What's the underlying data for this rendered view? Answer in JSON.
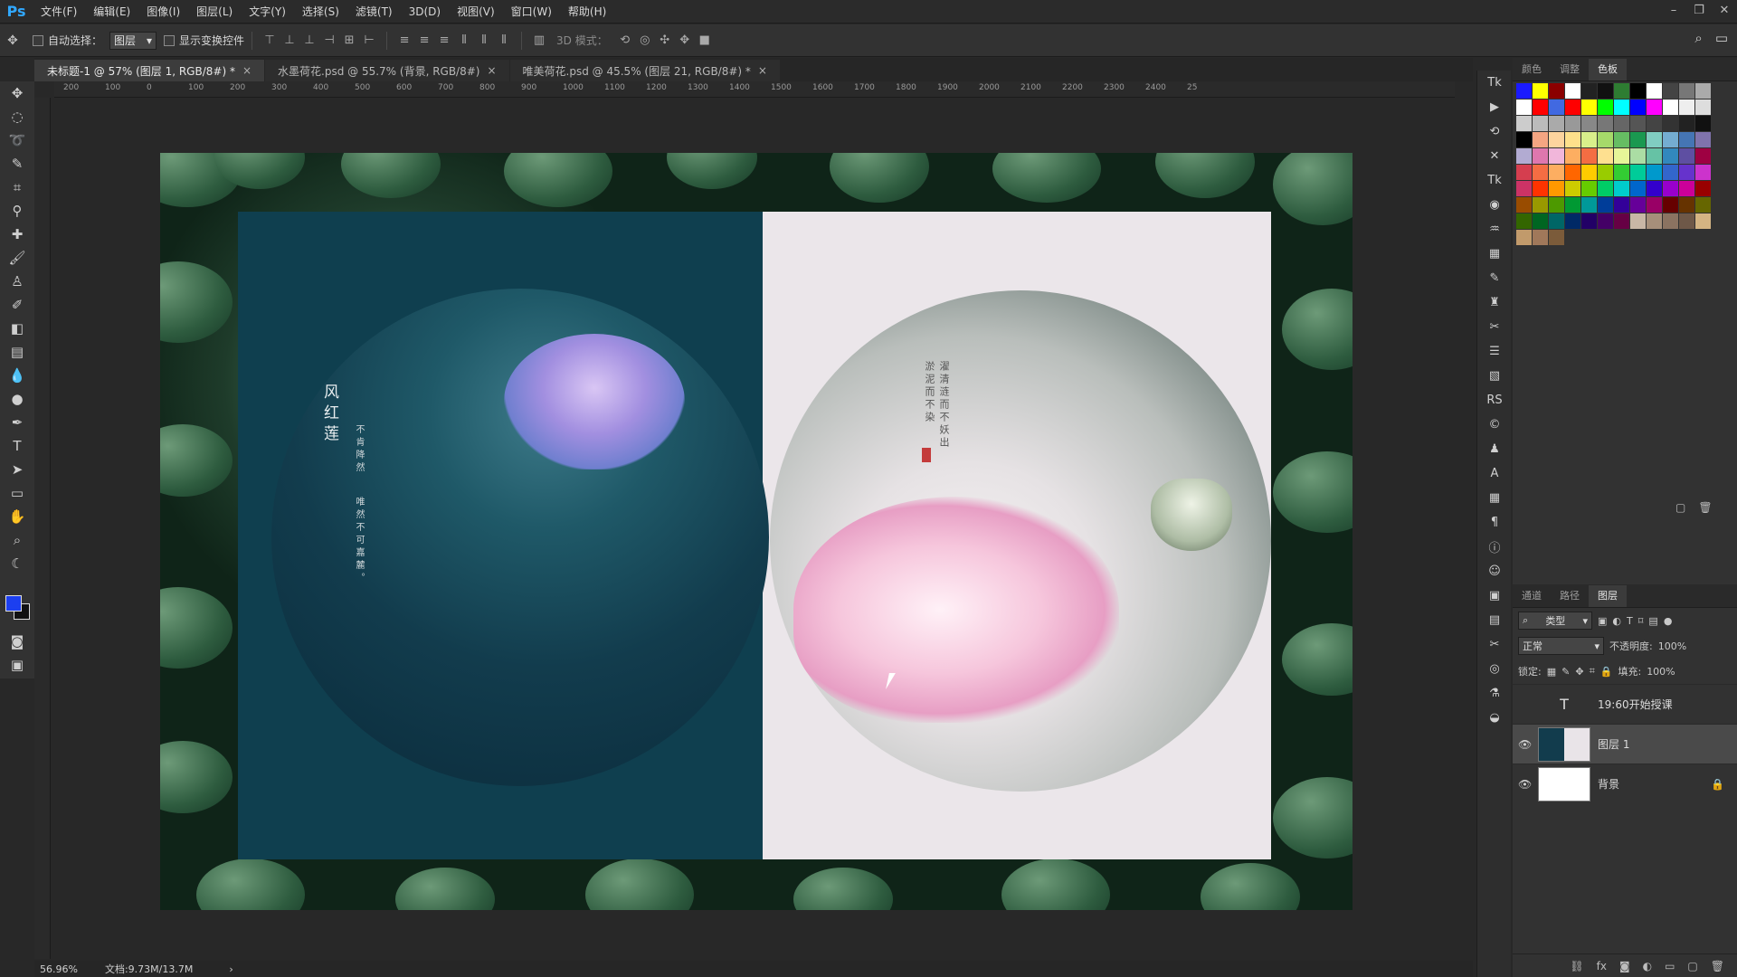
{
  "app": {
    "logo": "Ps"
  },
  "menu": [
    "文件(F)",
    "编辑(E)",
    "图像(I)",
    "图层(L)",
    "文字(Y)",
    "选择(S)",
    "滤镜(T)",
    "3D(D)",
    "视图(V)",
    "窗口(W)",
    "帮助(H)"
  ],
  "window_controls": [
    "–",
    "❐",
    "✕"
  ],
  "options": {
    "auto_select_label": "自动选择：",
    "auto_select_value": "图层",
    "show_transform_label": "显示变换控件",
    "mode_3d_label": "3D 模式："
  },
  "tabs": [
    {
      "label": "未标题-1 @ 57% (图层 1, RGB/8#) *",
      "close": "×"
    },
    {
      "label": "水墨荷花.psd @ 55.7% (背景, RGB/8#)",
      "close": "×"
    },
    {
      "label": "唯美荷花.psd @ 45.5% (图层 21, RGB/8#) *",
      "close": "×"
    }
  ],
  "ruler_ticks": [
    "200",
    "100",
    "0",
    "100",
    "200",
    "300",
    "400",
    "500",
    "600",
    "700",
    "800",
    "900",
    "1000",
    "1100",
    "1200",
    "1300",
    "1400",
    "1500",
    "1600",
    "1700",
    "1800",
    "1900",
    "2000",
    "2100",
    "2200",
    "2300",
    "2400",
    "25"
  ],
  "artwork": {
    "left_title": "风红莲",
    "left_poem_1": "不肯降然",
    "left_poem_2": "唯然不可嘉麓。",
    "right_poem": "濯清涟而不妖出淤泥而不染"
  },
  "status": {
    "zoom": "56.96%",
    "doc": "文档:9.73M/13.7M",
    "arrow": "›"
  },
  "swatches_panel": {
    "tabs": [
      "颜色",
      "调整",
      "色板"
    ],
    "active_tab": "色板",
    "colors": [
      "#1a1aff",
      "#ffff00",
      "#8b0000",
      "#ffffff",
      "#222222",
      "#111111",
      "#2e7d32",
      "#000000",
      "#ffffff",
      "#444444",
      "#777777",
      "#aaaaaa",
      "#ffffff",
      "#ff0000",
      "#4169e1",
      "#ff0000",
      "#ffff00",
      "#00ff00",
      "#00ffff",
      "#0000ff",
      "#ff00ff",
      "#ffffff",
      "#eeeeee",
      "#dddddd",
      "#cccccc",
      "#bbbbbb",
      "#aaaaaa",
      "#999999",
      "#888888",
      "#777777",
      "#666666",
      "#555555",
      "#444444",
      "#333333",
      "#222222",
      "#111111",
      "#000000",
      "#f4a582",
      "#fdd49e",
      "#fee08b",
      "#d9ef8b",
      "#a6d96a",
      "#66bd63",
      "#1a9850",
      "#80cdc1",
      "#74add1",
      "#4575b4",
      "#8073ac",
      "#b2abd2",
      "#de77ae",
      "#f1b6da",
      "#fdae61",
      "#f46d43",
      "#fee090",
      "#e6f598",
      "#abdda4",
      "#66c2a5",
      "#3288bd",
      "#5e4fa2",
      "#9e0142",
      "#d53e4f",
      "#f46d43",
      "#fdae61",
      "#ff6600",
      "#ffcc00",
      "#99cc00",
      "#33cc33",
      "#00cc99",
      "#0099cc",
      "#3366cc",
      "#6633cc",
      "#cc33cc",
      "#cc3366",
      "#ff3300",
      "#ff9900",
      "#cccc00",
      "#66cc00",
      "#00cc66",
      "#00cccc",
      "#0066cc",
      "#3300cc",
      "#9900cc",
      "#cc0099",
      "#990000",
      "#994c00",
      "#999900",
      "#4d9900",
      "#009933",
      "#009999",
      "#003d99",
      "#330099",
      "#660099",
      "#990066",
      "#660000",
      "#663300",
      "#666600",
      "#336600",
      "#006622",
      "#006666",
      "#002966",
      "#220066",
      "#440066",
      "#660044",
      "#c8b7a6",
      "#a68f7a",
      "#8b7361",
      "#6e5848",
      "#d4b483",
      "#c19a6b",
      "#a0785a",
      "#7b5b3a"
    ]
  },
  "layers_panel": {
    "tabs": [
      "通道",
      "路径",
      "图层"
    ],
    "active_tab": "图层",
    "filter_label": "类型",
    "blend_mode": "正常",
    "opacity_label": "不透明度:",
    "opacity_value": "100%",
    "lock_label": "锁定:",
    "fill_label": "填充:",
    "fill_value": "100%",
    "layers": [
      {
        "name": "19:60开始授课",
        "type": "text",
        "visible": false
      },
      {
        "name": "图层 1",
        "type": "image",
        "visible": true,
        "selected": true
      },
      {
        "name": "背景",
        "type": "background",
        "visible": true,
        "locked": true
      }
    ]
  }
}
